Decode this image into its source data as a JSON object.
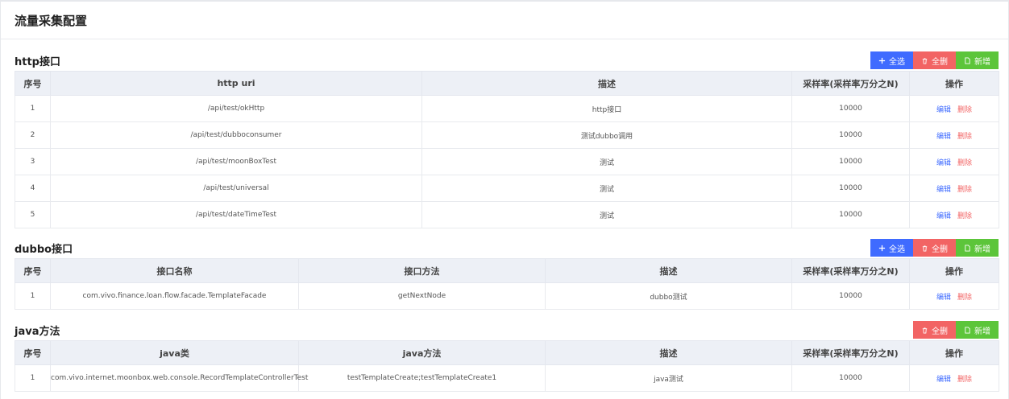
{
  "page": {
    "title": "流量采集配置"
  },
  "buttons": {
    "select_all": "全选",
    "delete_all": "全删",
    "add": "新增"
  },
  "ops": {
    "edit": "编辑",
    "delete": "删除"
  },
  "http": {
    "title": "http接口",
    "headers": [
      "序号",
      "http uri",
      "描述",
      "采样率(采样率万分之N)",
      "操作"
    ],
    "rows": [
      [
        "1",
        "/api/test/okHttp",
        "http接口",
        "10000"
      ],
      [
        "2",
        "/api/test/dubboconsumer",
        "测试dubbo调用",
        "10000"
      ],
      [
        "3",
        "/api/test/moonBoxTest",
        "测试",
        "10000"
      ],
      [
        "4",
        "/api/test/universal",
        "测试",
        "10000"
      ],
      [
        "5",
        "/api/test/dateTimeTest",
        "测试",
        "10000"
      ]
    ]
  },
  "dubbo": {
    "title": "dubbo接口",
    "headers": [
      "序号",
      "接口名称",
      "接口方法",
      "描述",
      "采样率(采样率万分之N)",
      "操作"
    ],
    "rows": [
      [
        "1",
        "com.vivo.finance.loan.flow.facade.TemplateFacade",
        "getNextNode",
        "dubbo测试",
        "10000"
      ]
    ]
  },
  "java": {
    "title": "java方法",
    "headers": [
      "序号",
      "java类",
      "java方法",
      "描述",
      "采样率(采样率万分之N)",
      "操作"
    ],
    "rows": [
      [
        "1",
        "com.vivo.internet.moonbox.web.console.RecordTemplateControllerTest",
        "testTemplateCreate;testTemplateCreate1",
        "java测试",
        "10000"
      ]
    ]
  }
}
